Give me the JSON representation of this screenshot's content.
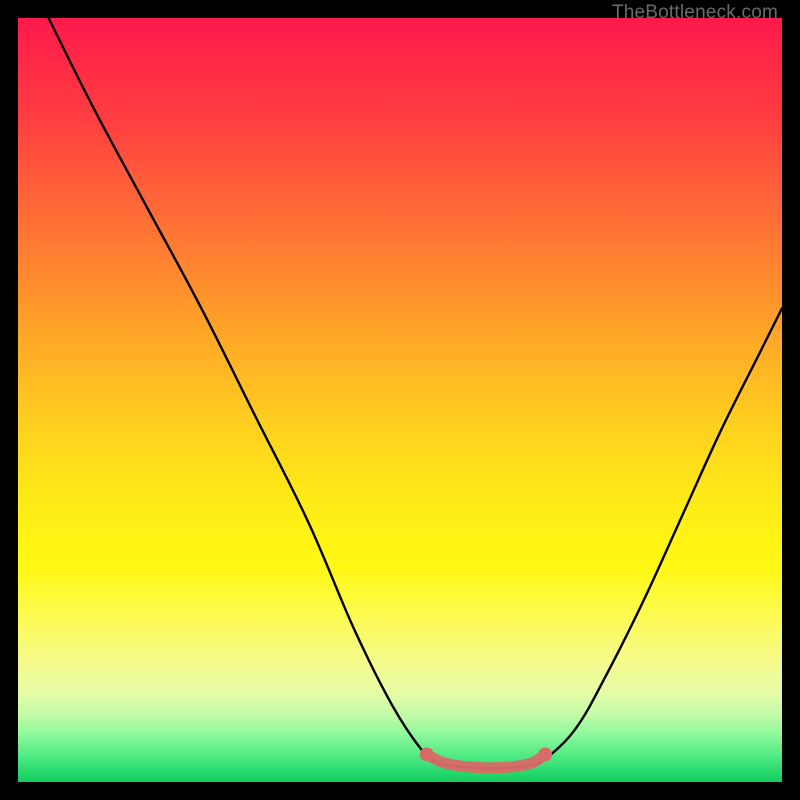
{
  "watermark": "TheBottleneck.com",
  "chart_data": {
    "type": "line",
    "title": "",
    "xlabel": "",
    "ylabel": "",
    "xlim": [
      0,
      100
    ],
    "ylim": [
      0,
      100
    ],
    "series": [
      {
        "name": "curve-left",
        "x": [
          4,
          10,
          17,
          24,
          31,
          38,
          44,
          49,
          53,
          55
        ],
        "y": [
          100,
          88,
          75,
          62,
          48,
          34,
          20,
          10,
          4,
          2.5
        ]
      },
      {
        "name": "curve-bottom",
        "x": [
          55,
          57,
          59,
          61,
          63,
          65,
          67,
          69
        ],
        "y": [
          2.5,
          2.1,
          1.9,
          1.8,
          1.8,
          1.9,
          2.2,
          3.0
        ]
      },
      {
        "name": "curve-right",
        "x": [
          69,
          73,
          77,
          82,
          87,
          92,
          97,
          100
        ],
        "y": [
          3.0,
          7,
          14,
          24,
          35,
          46,
          56,
          62
        ]
      }
    ],
    "markers": {
      "name": "highlight-band",
      "color": "#d86a68",
      "points": [
        {
          "x": 53.5,
          "y": 3.6
        },
        {
          "x": 55.5,
          "y": 2.6
        },
        {
          "x": 57.5,
          "y": 2.15
        },
        {
          "x": 59.5,
          "y": 1.95
        },
        {
          "x": 61.5,
          "y": 1.85
        },
        {
          "x": 63.5,
          "y": 1.9
        },
        {
          "x": 65.5,
          "y": 2.1
        },
        {
          "x": 67.5,
          "y": 2.6
        },
        {
          "x": 69.0,
          "y": 3.6
        }
      ]
    },
    "gradient_stops": [
      {
        "pos": 0,
        "color": "#ff1a4b"
      },
      {
        "pos": 50,
        "color": "#ffd21e"
      },
      {
        "pos": 78,
        "color": "#fdfb50"
      },
      {
        "pos": 100,
        "color": "#12cc60"
      }
    ]
  }
}
